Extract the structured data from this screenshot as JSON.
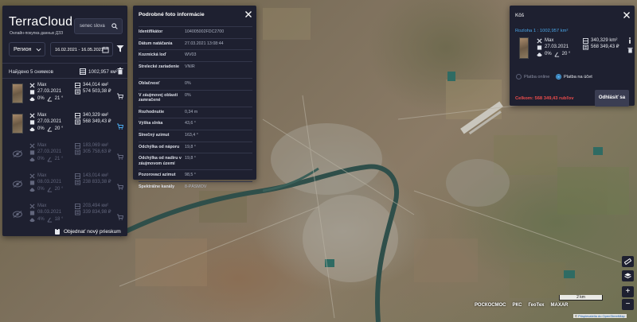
{
  "app": {
    "title": "TerraCloud",
    "subtitle": "Онлайн-покупка данных ДЗЗ"
  },
  "search": {
    "value": "senec slova"
  },
  "filters": {
    "region_label": "Регион",
    "date_range": "16.02.2021 - 16.05.2021"
  },
  "results": {
    "found_label": "Найдено 5 снимков",
    "total_area": "1002,957 км²",
    "items": [
      {
        "satellite": "Max",
        "date": "27.03.2021",
        "cloud": "0%",
        "angle": "21 °",
        "area": "344,014 км²",
        "price": "574 503,38 ₽",
        "thumb": true,
        "in_cart": false,
        "dimmed": false
      },
      {
        "satellite": "Max",
        "date": "27.03.2021",
        "cloud": "0%",
        "angle": "20 °",
        "area": "340,329 км²",
        "price": "568 349,43 ₽",
        "thumb": true,
        "in_cart": true,
        "dimmed": false
      },
      {
        "satellite": "Max",
        "date": "27.03.2021",
        "cloud": "0%",
        "angle": "21 °",
        "area": "183,069 км²",
        "price": "305 758,63 ₽",
        "thumb": false,
        "in_cart": false,
        "dimmed": true
      },
      {
        "satellite": "Max",
        "date": "08.03.2021",
        "cloud": "0%",
        "angle": "20 °",
        "area": "143,014 км²",
        "price": "238 833,38 ₽",
        "thumb": false,
        "in_cart": false,
        "dimmed": true
      },
      {
        "satellite": "Max",
        "date": "08.03.2021",
        "cloud": "4%",
        "angle": "18 °",
        "area": "203,494 км²",
        "price": "339 834,98 ₽",
        "thumb": false,
        "in_cart": false,
        "dimmed": true
      }
    ],
    "order_label": "Objednať nový prieskum"
  },
  "info": {
    "title": "Podrobné foto informácie",
    "rows": [
      {
        "k": "Identifikátor",
        "v": "104005002FDC2700"
      },
      {
        "k": "Dátum natáčania",
        "v": "27.03.2021 13:08:44"
      },
      {
        "k": "Kozmická loď",
        "v": "WV03"
      },
      {
        "k": "Strelecké zariadenie",
        "v": "VNIR"
      },
      {
        "k": "Oblačnosť",
        "v": "0%"
      },
      {
        "k": "V záujmovej oblasti zamračené",
        "v": "0%"
      },
      {
        "k": "Rozhodnutie",
        "v": "0,34 m"
      },
      {
        "k": "Výška slnka",
        "v": "43,6 °"
      },
      {
        "k": "Slnečný azimut",
        "v": "163,4 °"
      },
      {
        "k": "Odchýlka od náporu",
        "v": "19,8 °"
      },
      {
        "k": "Odchýlka od nadiru v záujmovom území",
        "v": "19,8 °"
      },
      {
        "k": "Pozorovací azimut",
        "v": "98,5 °"
      },
      {
        "k": "Spektrálne kanály",
        "v": "8-PÁSMOV"
      }
    ]
  },
  "basket": {
    "title": "Kôš",
    "subtitle": "Rozloha 1 : 1002,957 km²",
    "item": {
      "satellite": "Max",
      "date": "27.03.2021",
      "cloud": "0%",
      "angle": "20 °",
      "area": "340,329 km²",
      "price": "568 349,43 ₽"
    },
    "pay_online": "Platba online",
    "pay_account": "Platba na účet",
    "total": "Celkom: 568 349,43 rubľov",
    "submit": "Odhlásiť sa"
  },
  "map": {
    "scale": "2 km",
    "logos": [
      "РОСКОСМОС",
      "РКС",
      "ГеоТех",
      "MAXAR"
    ],
    "attribution_prefix": "©",
    "attribution_link": "Prispievatelia do OpenStreetMap"
  },
  "colors": {
    "panel": "#1e2030",
    "accent": "#4aa6e8",
    "danger": "#e94b4b"
  }
}
